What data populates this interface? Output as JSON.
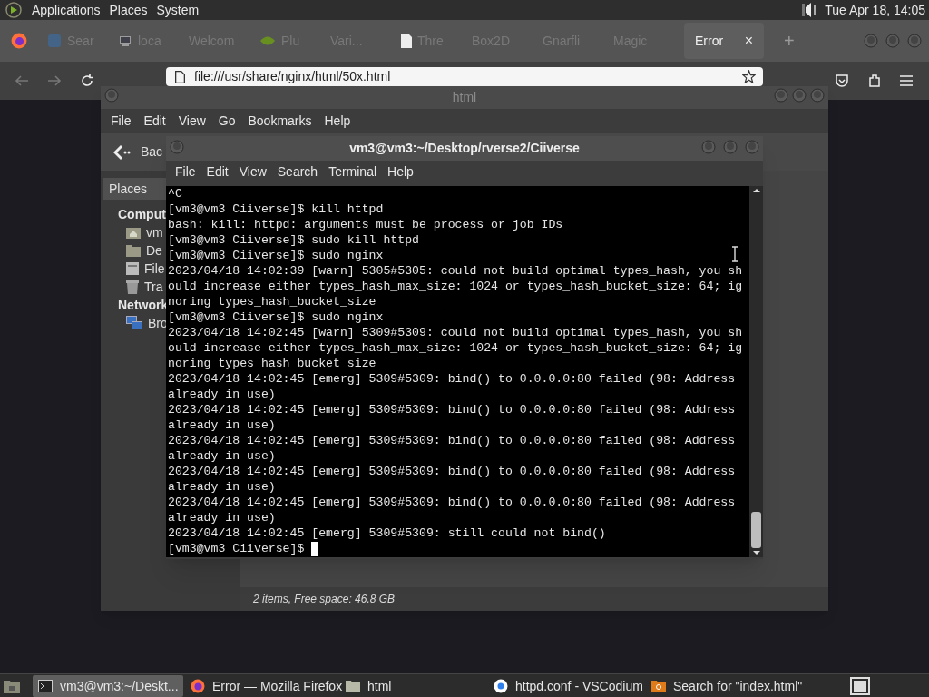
{
  "top_panel": {
    "menus": [
      "Applications",
      "Places",
      "System"
    ],
    "clock": "Tue Apr 18, 14:05"
  },
  "browser": {
    "tabs": [
      {
        "label": "Sear",
        "selected": false
      },
      {
        "label": "loca",
        "selected": false
      },
      {
        "label": "Welcom",
        "selected": false
      },
      {
        "label": "Plu",
        "selected": false
      },
      {
        "label": "Vari...",
        "selected": false
      },
      {
        "label": "Thre",
        "selected": false
      },
      {
        "label": "Box2D",
        "selected": false
      },
      {
        "label": "Gnarfli",
        "selected": false
      },
      {
        "label": "Magic",
        "selected": false
      },
      {
        "label": "Error",
        "selected": true
      }
    ],
    "close_glyph": "×",
    "new_tab_glyph": "+",
    "url": "file:///usr/share/nginx/html/50x.html"
  },
  "file_manager": {
    "title": "html",
    "menu": [
      "File",
      "Edit",
      "View",
      "Go",
      "Bookmarks",
      "Help"
    ],
    "back": "Bac",
    "places_header": "Places",
    "sidebar": [
      {
        "kind": "heading",
        "label": "Comput"
      },
      {
        "kind": "home",
        "label": "vm"
      },
      {
        "kind": "folder",
        "label": "De"
      },
      {
        "kind": "drive",
        "label": "File"
      },
      {
        "kind": "trash",
        "label": "Tra"
      },
      {
        "kind": "heading",
        "label": "Network"
      },
      {
        "kind": "network",
        "label": "Bro"
      }
    ],
    "status": "2 items, Free space: 46.8 GB"
  },
  "terminal": {
    "title": "vm3@vm3:~/Desktop/rverse2/Ciiverse",
    "menu": [
      "File",
      "Edit",
      "View",
      "Search",
      "Terminal",
      "Help"
    ],
    "lines": [
      "^C",
      "[vm3@vm3 Ciiverse]$ kill httpd",
      "bash: kill: httpd: arguments must be process or job IDs",
      "[vm3@vm3 Ciiverse]$ sudo kill httpd",
      "[vm3@vm3 Ciiverse]$ sudo nginx",
      "2023/04/18 14:02:39 [warn] 5305#5305: could not build optimal types_hash, you sh",
      "ould increase either types_hash_max_size: 1024 or types_hash_bucket_size: 64; ig",
      "noring types_hash_bucket_size",
      "[vm3@vm3 Ciiverse]$ sudo nginx",
      "2023/04/18 14:02:45 [warn] 5309#5309: could not build optimal types_hash, you sh",
      "ould increase either types_hash_max_size: 1024 or types_hash_bucket_size: 64; ig",
      "noring types_hash_bucket_size",
      "2023/04/18 14:02:45 [emerg] 5309#5309: bind() to 0.0.0.0:80 failed (98: Address",
      "already in use)",
      "2023/04/18 14:02:45 [emerg] 5309#5309: bind() to 0.0.0.0:80 failed (98: Address",
      "already in use)",
      "2023/04/18 14:02:45 [emerg] 5309#5309: bind() to 0.0.0.0:80 failed (98: Address",
      "already in use)",
      "2023/04/18 14:02:45 [emerg] 5309#5309: bind() to 0.0.0.0:80 failed (98: Address",
      "already in use)",
      "2023/04/18 14:02:45 [emerg] 5309#5309: bind() to 0.0.0.0:80 failed (98: Address",
      "already in use)",
      "2023/04/18 14:02:45 [emerg] 5309#5309: still could not bind()"
    ],
    "prompt": "[vm3@vm3 Ciiverse]$ "
  },
  "taskbar": [
    {
      "kind": "terminal",
      "label": "vm3@vm3:~/Deskt...",
      "selected": true
    },
    {
      "kind": "firefox",
      "label": "Error — Mozilla Firefox",
      "selected": false
    },
    {
      "kind": "folder",
      "label": "html",
      "selected": false
    },
    {
      "kind": "vscodium",
      "label": "httpd.conf - VSCodium",
      "selected": false
    },
    {
      "kind": "search",
      "label": "Search for \"index.html\"",
      "selected": false
    }
  ]
}
